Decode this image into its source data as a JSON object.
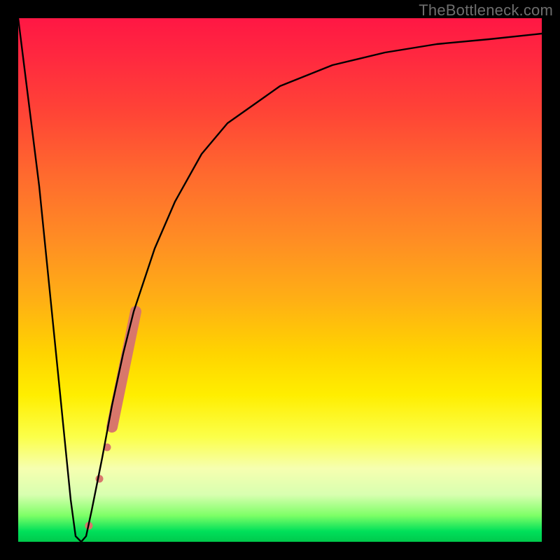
{
  "watermark": "TheBottleneck.com",
  "chart_data": {
    "type": "line",
    "title": "",
    "xlabel": "",
    "ylabel": "",
    "xlim": [
      0,
      100
    ],
    "ylim": [
      0,
      100
    ],
    "grid": false,
    "legend": false,
    "background_gradient": {
      "direction": "vertical",
      "stops": [
        {
          "pos": 0.0,
          "color": "#ff1744"
        },
        {
          "pos": 0.5,
          "color": "#ffb014"
        },
        {
          "pos": 0.75,
          "color": "#ffee00"
        },
        {
          "pos": 0.95,
          "color": "#7dff66"
        },
        {
          "pos": 1.0,
          "color": "#00c94c"
        }
      ]
    },
    "series": [
      {
        "name": "curve",
        "stroke": "#000000",
        "stroke_width": 2,
        "x": [
          0,
          4,
          8,
          10,
          11,
          12,
          13,
          14,
          16,
          18,
          20,
          22,
          24,
          26,
          30,
          35,
          40,
          50,
          60,
          70,
          80,
          90,
          100
        ],
        "values": [
          100,
          68,
          28,
          8,
          1,
          0,
          1,
          6,
          16,
          26,
          36,
          44,
          50,
          56,
          65,
          74,
          80,
          87,
          91,
          93.5,
          95,
          96,
          97
        ]
      }
    ],
    "markers": {
      "name": "highlight-capsule",
      "color": "#d8776b",
      "points": [
        {
          "x": 13.5,
          "y": 3,
          "r": 5
        },
        {
          "x": 15.5,
          "y": 12,
          "r": 5
        },
        {
          "x": 17.0,
          "y": 18,
          "r": 5
        },
        {
          "x": 18.0,
          "y": 22,
          "r": 8,
          "segment_start": true
        },
        {
          "x": 22.5,
          "y": 44,
          "r": 8,
          "segment_end": true
        }
      ]
    }
  }
}
